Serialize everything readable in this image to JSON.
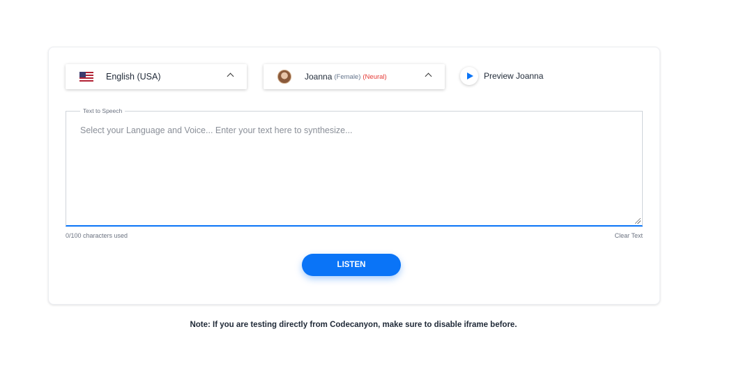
{
  "language_select": {
    "flag_icon": "us-flag-icon",
    "label": "English (USA)"
  },
  "voice_select": {
    "name": "Joanna",
    "gender": "(Female)",
    "engine": "(Neural)"
  },
  "preview": {
    "label": "Preview Joanna"
  },
  "text_to_speech": {
    "legend": "Text to Speech",
    "placeholder": "Select your Language and Voice... Enter your text here to synthesize...",
    "char_count": "0/100 characters used",
    "clear_label": "Clear Text"
  },
  "listen_button": {
    "label": "LISTEN"
  },
  "note": "Note: If you are testing directly from Codecanyon, make sure to disable iframe before.",
  "colors": {
    "accent": "#0a74f7",
    "engine_red": "#e53935",
    "muted": "#64748b"
  }
}
